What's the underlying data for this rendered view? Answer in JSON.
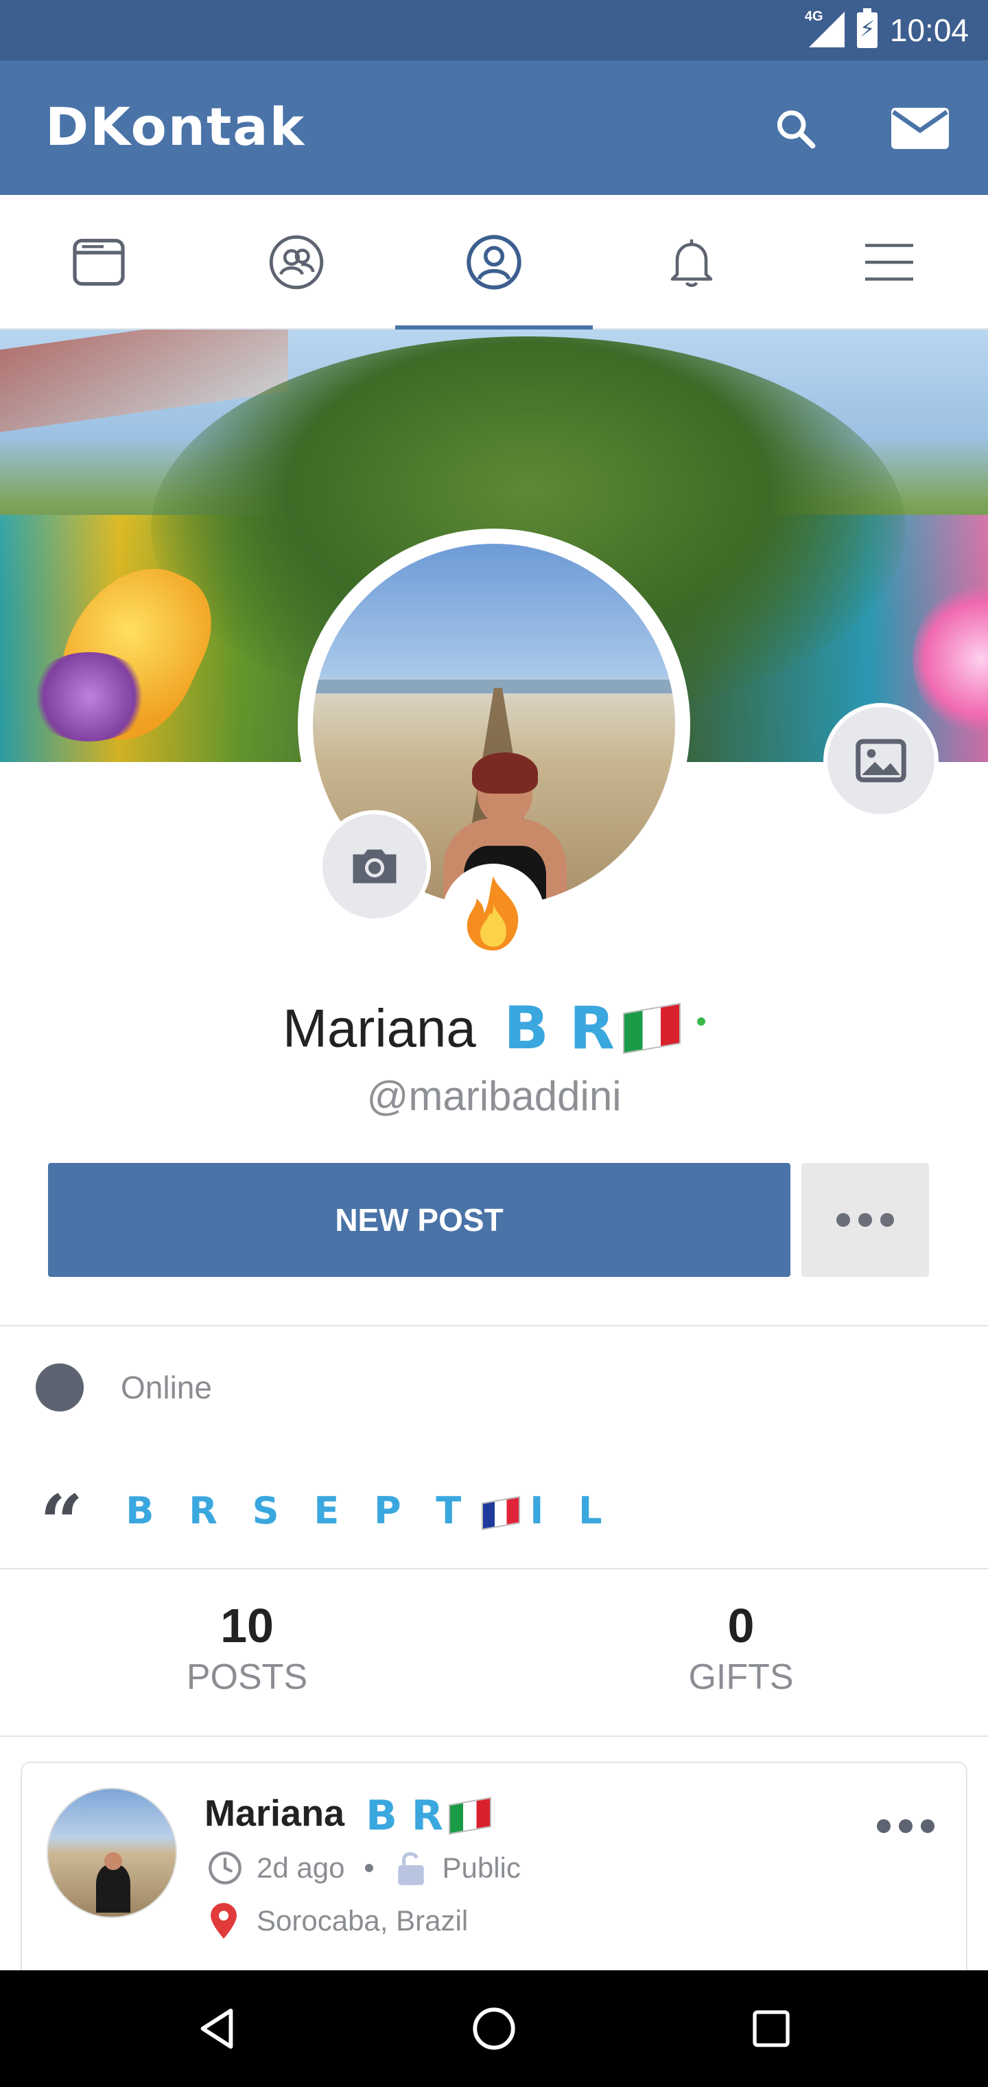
{
  "status_bar": {
    "time": "10:04",
    "network": "4G",
    "icons": [
      "signal-icon",
      "battery-charging-icon"
    ]
  },
  "app_bar": {
    "logo": "DKontak",
    "icons": [
      "search-icon",
      "mail-icon"
    ]
  },
  "tabs": [
    {
      "name": "tab-feed",
      "icon": "newsfeed-icon",
      "active": false
    },
    {
      "name": "tab-friends",
      "icon": "friends-icon",
      "active": false
    },
    {
      "name": "tab-profile",
      "icon": "profile-icon",
      "active": true
    },
    {
      "name": "tab-notifications",
      "icon": "bell-icon",
      "active": false
    },
    {
      "name": "tab-menu",
      "icon": "menu-icon",
      "active": false
    }
  ],
  "profile": {
    "name": "Mariana",
    "name_styled": "B R",
    "name_flag": "italy-flag",
    "handle": "@maribaddini",
    "badge_icon": "fire-icon",
    "presence_color": "#3cb84c"
  },
  "actions": {
    "new_post": "NEW POST",
    "more_icon": "more-horizontal-icon"
  },
  "status": {
    "label": "Online"
  },
  "bio": {
    "quote_icon": "quote-icon",
    "part1": "B R S E P T",
    "flag": "france-flag",
    "part2": "I L"
  },
  "stats": [
    {
      "value": "10",
      "label": "POSTS"
    },
    {
      "value": "0",
      "label": "GIFTS"
    }
  ],
  "post": {
    "author": "Mariana",
    "author_styled": "B R",
    "time": "2d ago",
    "visibility": "Public",
    "location": "Sorocaba, Brazil"
  },
  "nav_bar": {
    "icons": [
      "back-icon",
      "home-icon",
      "recents-icon"
    ]
  },
  "colors": {
    "primary": "#4a73a8",
    "status_bar": "#3d5f8f",
    "accent_text": "#3aa7df",
    "location_pin": "#e03a3a"
  }
}
